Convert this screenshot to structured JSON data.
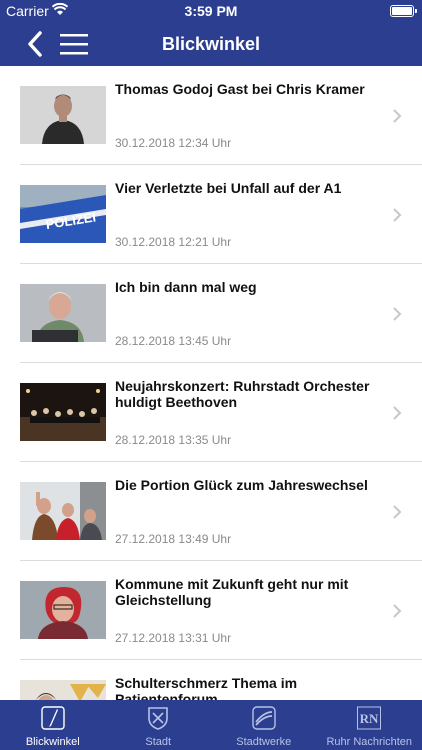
{
  "status": {
    "carrier": "Carrier",
    "time": "3:59 PM"
  },
  "nav": {
    "title": "Blickwinkel"
  },
  "items": [
    {
      "title": "Thomas Godoj Gast bei Chris Kramer",
      "date": "30.12.2018 12:34 Uhr"
    },
    {
      "title": "Vier Verletzte bei Unfall auf der A1",
      "date": "30.12.2018 12:21 Uhr"
    },
    {
      "title": "Ich bin dann mal weg",
      "date": "28.12.2018 13:45 Uhr"
    },
    {
      "title": "Neujahrskonzert: Ruhrstadt Orchester huldigt Beethoven",
      "date": "28.12.2018 13:35 Uhr"
    },
    {
      "title": "Die Portion Glück zum Jahreswechsel",
      "date": "27.12.2018 13:49 Uhr"
    },
    {
      "title": "Kommune mit Zukunft geht nur mit Gleichstellung",
      "date": "27.12.2018 13:31 Uhr"
    },
    {
      "title": "Schulterschmerz Thema im Patientenforum",
      "date": ""
    }
  ],
  "thumb_text": {
    "polizei": "POLIZEI"
  },
  "tabs": [
    {
      "label": "Blickwinkel",
      "icon": "pen-icon"
    },
    {
      "label": "Stadt",
      "icon": "city-crest-icon"
    },
    {
      "label": "Stadtwerke",
      "icon": "stadtwerke-logo-icon"
    },
    {
      "label": "Ruhr Nachrichten",
      "icon": "rn-logo-icon",
      "icon_text": "RN"
    }
  ],
  "colors": {
    "brand": "#2c3e8f",
    "separator": "#dcdcdc",
    "date": "#8a8a8a"
  }
}
